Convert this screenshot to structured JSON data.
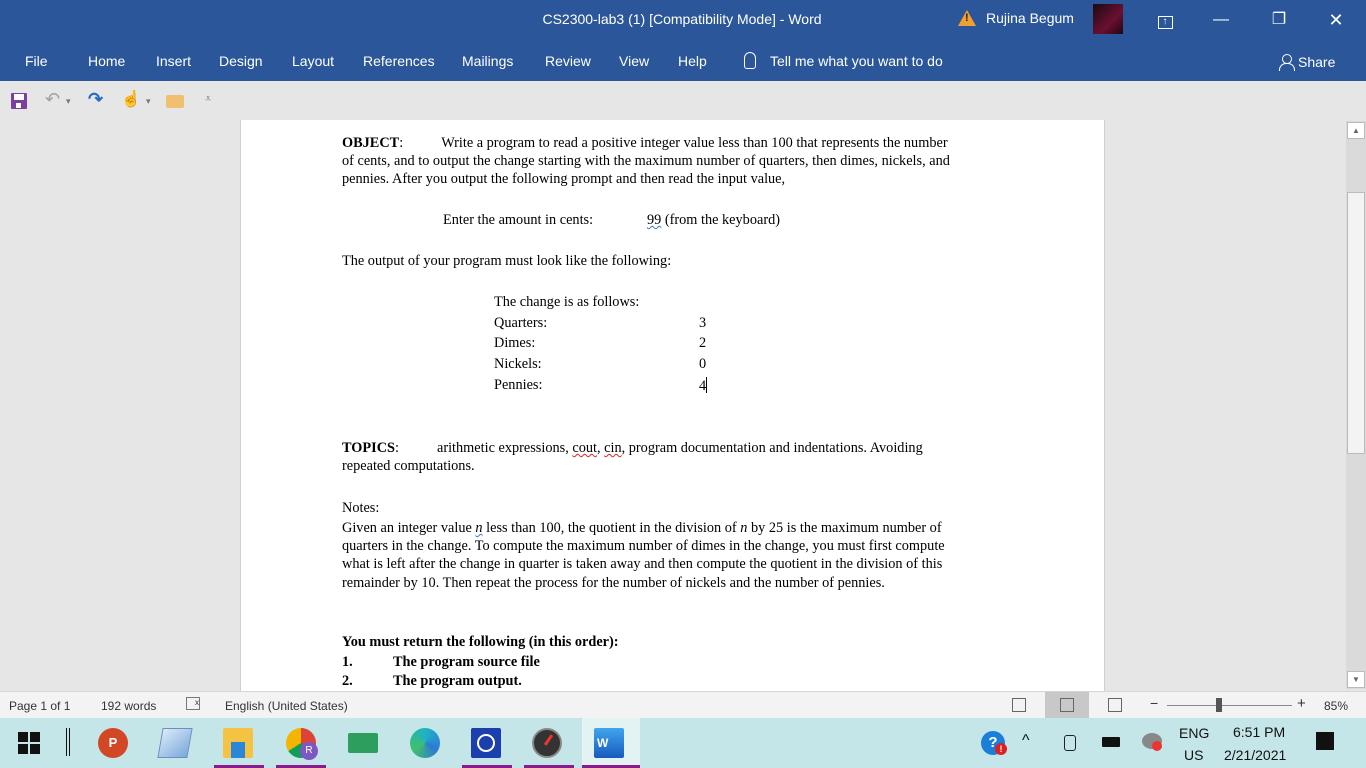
{
  "window": {
    "title": "CS2300-lab3 (1) [Compatibility Mode]  -  Word",
    "user_name": "Rujina Begum",
    "controls": {
      "ribbon_display": "⊼",
      "minimize": "—",
      "restore": "❐",
      "close": "✕"
    }
  },
  "ribbon": {
    "tabs": [
      "File",
      "Home",
      "Insert",
      "Design",
      "Layout",
      "References",
      "Mailings",
      "Review",
      "View",
      "Help"
    ],
    "tell_me": "Tell me what you want to do",
    "share": "Share"
  },
  "quick_access": {
    "icons": [
      "save-icon",
      "undo-icon",
      "redo-icon",
      "touch-mode-icon",
      "open-folder-icon",
      "customize-icon"
    ],
    "undo_glyph": "↶",
    "redo_glyph": "↷",
    "touch_glyph": "☝",
    "dropdown_glyph": "▾",
    "customize_glyph": "⩡"
  },
  "document": {
    "object_label": "OBJECT",
    "object_colon": ":",
    "object_text_1": "Write a program to read a positive integer value less than 100 that represents the number",
    "object_text_2": "of cents, and to output the change starting with the maximum number of quarters, then dimes, nickels, and",
    "object_text_3": "pennies.  After you output the following prompt and then read the input value,",
    "prompt_label": "Enter the amount in cents:",
    "prompt_value": "99",
    "prompt_note": " (from the keyboard)",
    "output_intro": "The output of your program must look like the following:",
    "change_header": "The change is as follows:",
    "change_rows": [
      {
        "label": "Quarters:",
        "value": "3"
      },
      {
        "label": "Dimes:",
        "value": "2"
      },
      {
        "label": "Nickels:",
        "value": "0"
      },
      {
        "label": "Pennies:",
        "value": "4"
      }
    ],
    "topics_label": "TOPICS",
    "topics_colon": ":",
    "topics_pre": "arithmetic expressions, ",
    "topics_cout": "cout",
    "topics_sep": ", ",
    "topics_cin": "cin",
    "topics_post": ", program documentation and indentations.  Avoiding",
    "topics_line2": "repeated computations.",
    "notes_label": "Notes:",
    "notes_1a": "Given an integer value ",
    "notes_n": "n",
    "notes_1b": " less than 100, the quotient in the division of ",
    "notes_n2": "n",
    "notes_1c": " by 25 is the maximum number of",
    "notes_2": "quarters in the change.  To compute the maximum number of dimes in the change, you must first compute",
    "notes_3": "what is left after the change in quarter is taken away and then compute the quotient in the division of this",
    "notes_4": "remainder by 10.  Then repeat the process for the number of nickels and the number of pennies.",
    "return_header": "You must return the following (in this order):",
    "return_items": [
      {
        "num": "1.",
        "text": "The program source file"
      },
      {
        "num": "2.",
        "text": "The program output."
      }
    ]
  },
  "statusbar": {
    "page": "Page 1 of 1",
    "words": "192 words",
    "language": "English (United States)",
    "zoom_percent": "85%",
    "zoom_value": 85,
    "minus": "−",
    "plus": "+"
  },
  "taskbar": {
    "apps": [
      "start",
      "powerpoint",
      "app-window",
      "file-explorer",
      "chrome",
      "card-app",
      "edge",
      "sync-app",
      "speedtest",
      "word"
    ],
    "lang_top": "ENG",
    "lang_bottom": "US",
    "time": "6:51 PM",
    "date": "2/21/2021"
  }
}
